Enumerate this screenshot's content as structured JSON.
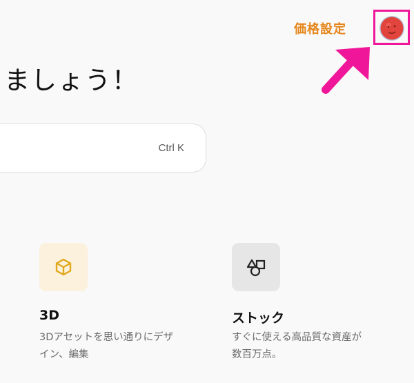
{
  "header": {
    "pricing_label": "価格設定",
    "avatar_icon": "user-avatar-icon"
  },
  "main": {
    "heading": "ましょう！",
    "search": {
      "shortcut": "Ctrl K"
    }
  },
  "cards": [
    {
      "title": "3D",
      "description": "3Dアセットを思い通りにデザイン、編集",
      "icon": "cube-icon",
      "tile_color": "#fbf1dc",
      "icon_color": "#e0a81a"
    },
    {
      "title": "ストック",
      "description": "すぐに使える高品質な資産が数百万点。",
      "icon": "shapes-icon",
      "tile_color": "#e6e6e6",
      "icon_color": "#222222"
    }
  ],
  "colors": {
    "accent_orange": "#e5861b",
    "highlight_pink": "#f0169a",
    "background": "#f9f9f9"
  }
}
